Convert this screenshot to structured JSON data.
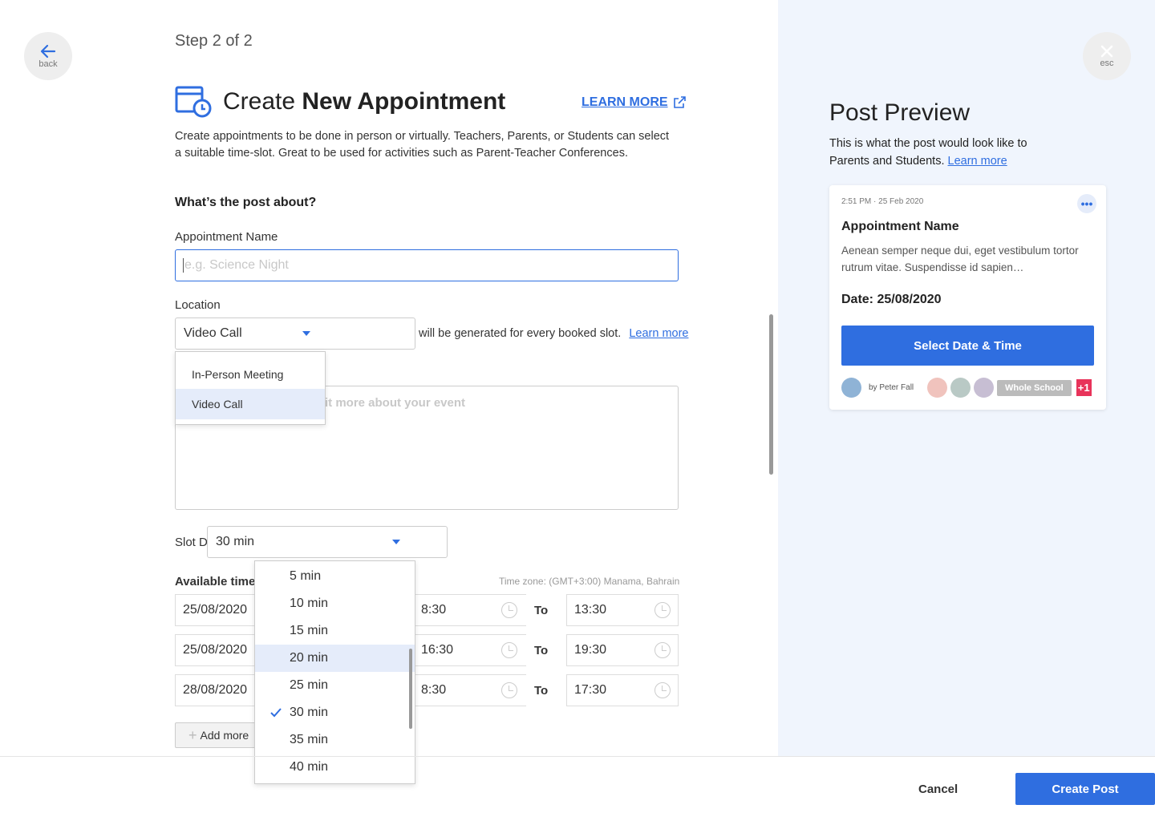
{
  "nav": {
    "back_label": "back",
    "esc_label": "esc"
  },
  "header": {
    "step": "Step 2 of 2",
    "title_prefix": "Create",
    "title_bold": "New Appointment",
    "learn_more": "LEARN MORE",
    "description": "Create appointments to be done in person or virtually. Teachers, Parents, or Students can select a suitable time-slot. Great to be used for activities such as Parent-Teacher Conferences."
  },
  "form": {
    "section_title": "What’s the post about?",
    "name_label": "Appointment Name",
    "name_placeholder": "e.g. Science Night",
    "location_label": "Location",
    "location_value": "Video Call",
    "location_note": "will be generated for every booked slot.",
    "location_learn_more": "Learn more",
    "location_options": [
      "In-Person Meeting",
      "Video Call"
    ],
    "location_highlighted": "Video Call",
    "description_placeholder": "it more about your event",
    "slot_label": "Slot Duration",
    "slot_value": "30 min",
    "slot_options": [
      "5 min",
      "10 min",
      "15 min",
      "20 min",
      "25 min",
      "30 min",
      "35 min",
      "40 min"
    ],
    "slot_highlighted": "20 min",
    "slot_selected": "30 min",
    "available_label": "Available times",
    "timezone": "Time zone: (GMT+3:00) Manama, Bahrain",
    "to_label": "To",
    "rows": [
      {
        "date": "25/08/2020",
        "from": "8:30",
        "to": "13:30"
      },
      {
        "date": "25/08/2020",
        "from": "16:30",
        "to": "19:30"
      },
      {
        "date": "28/08/2020",
        "from": "8:30",
        "to": "17:30"
      }
    ],
    "add_more": "Add more"
  },
  "preview": {
    "title": "Post Preview",
    "subtitle": "This is what the post would look like to Parents and Students.",
    "learn_more": "Learn more",
    "card": {
      "timestamp": "2:51 PM · 25 Feb 2020",
      "name": "Appointment Name",
      "body": "Aenean semper neque dui, eget vestibulum tortor rutrum vitae. Suspendisse id sapien…",
      "date": "Date: 25/08/2020",
      "cta": "Select Date & Time",
      "author": "by Peter Fall",
      "audience": "Whole School",
      "more_count": "+1"
    }
  },
  "footer": {
    "cancel": "Cancel",
    "create": "Create Post"
  },
  "colors": {
    "accent": "#2f6ee0",
    "panel_bg": "#f0f5fd",
    "highlight": "#e5ecfa",
    "badge_red": "#e8335a"
  }
}
